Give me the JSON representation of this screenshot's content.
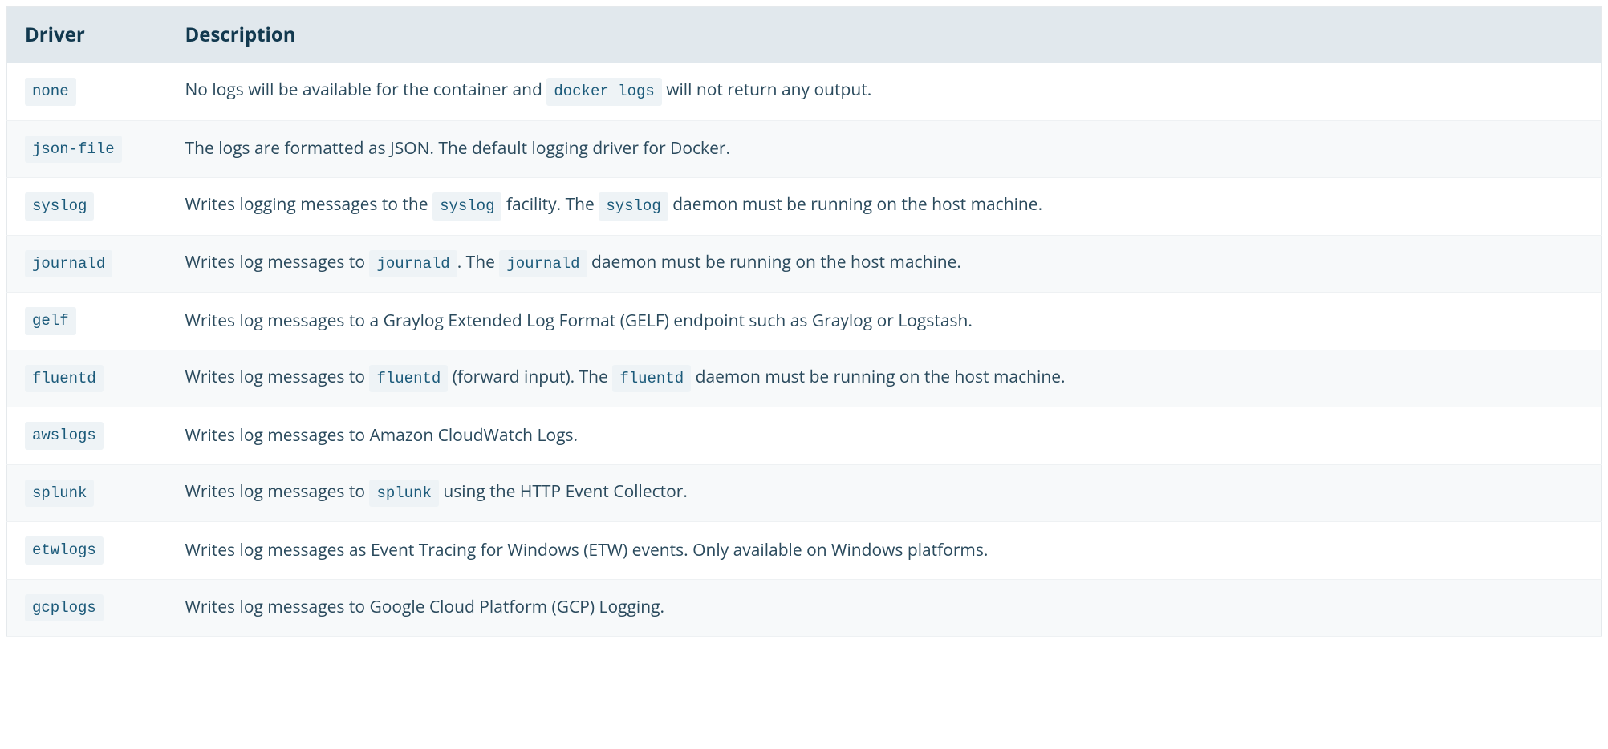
{
  "table": {
    "headers": {
      "driver": "Driver",
      "description": "Description"
    },
    "rows": [
      {
        "driver": "none",
        "description_parts": [
          {
            "type": "text",
            "value": "No logs will be available for the container and "
          },
          {
            "type": "code",
            "value": "docker logs"
          },
          {
            "type": "text",
            "value": " will not return any output."
          }
        ]
      },
      {
        "driver": "json-file",
        "description_parts": [
          {
            "type": "text",
            "value": "The logs are formatted as JSON. The default logging driver for Docker."
          }
        ]
      },
      {
        "driver": "syslog",
        "description_parts": [
          {
            "type": "text",
            "value": "Writes logging messages to the "
          },
          {
            "type": "code",
            "value": "syslog"
          },
          {
            "type": "text",
            "value": " facility. The "
          },
          {
            "type": "code",
            "value": "syslog"
          },
          {
            "type": "text",
            "value": " daemon must be running on the host machine."
          }
        ]
      },
      {
        "driver": "journald",
        "description_parts": [
          {
            "type": "text",
            "value": "Writes log messages to "
          },
          {
            "type": "code",
            "value": "journald"
          },
          {
            "type": "text",
            "value": ". The "
          },
          {
            "type": "code",
            "value": "journald"
          },
          {
            "type": "text",
            "value": " daemon must be running on the host machine."
          }
        ]
      },
      {
        "driver": "gelf",
        "description_parts": [
          {
            "type": "text",
            "value": "Writes log messages to a Graylog Extended Log Format (GELF) endpoint such as Graylog or Logstash."
          }
        ]
      },
      {
        "driver": "fluentd",
        "description_parts": [
          {
            "type": "text",
            "value": "Writes log messages to "
          },
          {
            "type": "code",
            "value": "fluentd"
          },
          {
            "type": "text",
            "value": " (forward input). The "
          },
          {
            "type": "code",
            "value": "fluentd"
          },
          {
            "type": "text",
            "value": " daemon must be running on the host machine."
          }
        ]
      },
      {
        "driver": "awslogs",
        "description_parts": [
          {
            "type": "text",
            "value": "Writes log messages to Amazon CloudWatch Logs."
          }
        ]
      },
      {
        "driver": "splunk",
        "description_parts": [
          {
            "type": "text",
            "value": "Writes log messages to "
          },
          {
            "type": "code",
            "value": "splunk"
          },
          {
            "type": "text",
            "value": " using the HTTP Event Collector."
          }
        ]
      },
      {
        "driver": "etwlogs",
        "description_parts": [
          {
            "type": "text",
            "value": "Writes log messages as Event Tracing for Windows (ETW) events. Only available on Windows platforms."
          }
        ]
      },
      {
        "driver": "gcplogs",
        "description_parts": [
          {
            "type": "text",
            "value": "Writes log messages to Google Cloud Platform (GCP) Logging."
          }
        ]
      }
    ]
  }
}
